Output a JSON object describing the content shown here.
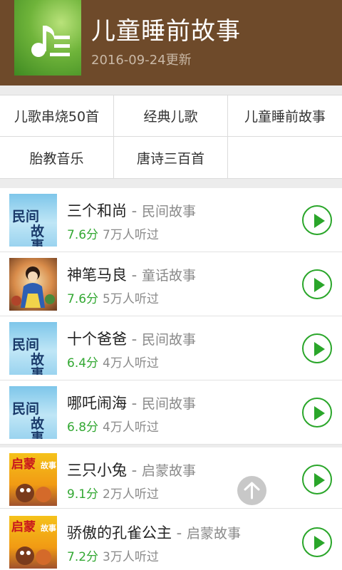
{
  "header": {
    "title": "儿童睡前故事",
    "updated": "2016-09-24更新",
    "thumb_icon": "music-note-list-icon"
  },
  "categories": [
    {
      "label": "儿歌串烧50首"
    },
    {
      "label": "经典儿歌"
    },
    {
      "label": "儿童睡前故事"
    },
    {
      "label": "胎教音乐"
    },
    {
      "label": "唐诗三百首"
    }
  ],
  "stories": [
    {
      "title": "三个和尚",
      "separator": " - ",
      "genre": "民间故事",
      "score": "7.6分",
      "plays": "7万人听过",
      "cover_text": [
        "民间",
        "故事"
      ]
    },
    {
      "title": "神笔马良",
      "separator": " - ",
      "genre": "童话故事",
      "score": "7.6分",
      "plays": "5万人听过"
    },
    {
      "title": "十个爸爸",
      "separator": " - ",
      "genre": "民间故事",
      "score": "6.4分",
      "plays": "4万人听过",
      "cover_text": [
        "民间",
        "故事"
      ]
    },
    {
      "title": "哪吒闹海",
      "separator": " - ",
      "genre": "民间故事",
      "score": "6.8分",
      "plays": "4万人听过",
      "cover_text": [
        "民间",
        "故事"
      ]
    },
    {
      "title": "三只小兔",
      "separator": " - ",
      "genre": "启蒙故事",
      "score": "9.1分",
      "plays": "2万人听过",
      "cover_text": [
        "启蒙",
        "故事"
      ]
    },
    {
      "title": "骄傲的孔雀公主",
      "separator": " - ",
      "genre": "启蒙故事",
      "score": "7.2分",
      "plays": "3万人听过",
      "cover_text": [
        "启蒙",
        "故事"
      ]
    }
  ],
  "colors": {
    "header_bg": "#6e4a2a",
    "accent_green": "#2aa62a",
    "score_green": "#32a832"
  },
  "icons": {
    "play": "play-circle-icon",
    "scroll_top": "arrow-up-icon"
  }
}
